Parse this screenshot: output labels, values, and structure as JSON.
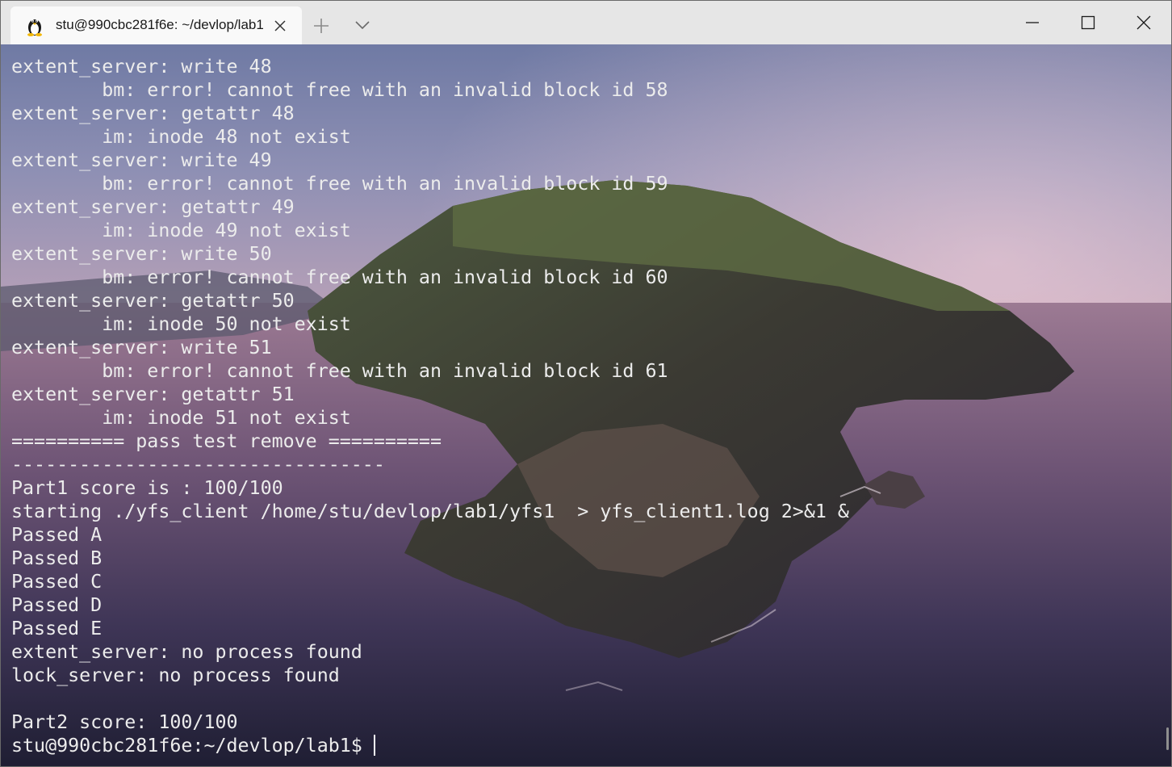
{
  "window": {
    "tab_title": "stu@990cbc281f6e: ~/devlop/lab1",
    "tab_icon": "linux-penguin-icon"
  },
  "terminal": {
    "lines": [
      "extent_server: write 48",
      "        bm: error! cannot free with an invalid block id 58",
      "extent_server: getattr 48",
      "        im: inode 48 not exist",
      "extent_server: write 49",
      "        bm: error! cannot free with an invalid block id 59",
      "extent_server: getattr 49",
      "        im: inode 49 not exist",
      "extent_server: write 50",
      "        bm: error! cannot free with an invalid block id 60",
      "extent_server: getattr 50",
      "        im: inode 50 not exist",
      "extent_server: write 51",
      "        bm: error! cannot free with an invalid block id 61",
      "extent_server: getattr 51",
      "        im: inode 51 not exist",
      "========== pass test remove ==========",
      "---------------------------------",
      "Part1 score is : 100/100",
      "starting ./yfs_client /home/stu/devlop/lab1/yfs1  > yfs_client1.log 2>&1 &",
      "Passed A",
      "Passed B",
      "Passed C",
      "Passed D",
      "Passed E",
      "extent_server: no process found",
      "lock_server: no process found",
      "",
      "Part2 score: 100/100"
    ],
    "prompt": "stu@990cbc281f6e:~/devlop/lab1$"
  },
  "colors": {
    "titlebar": "#e6e6e6",
    "tab": "#f9f9f9",
    "terminal_text": "#ececec"
  }
}
